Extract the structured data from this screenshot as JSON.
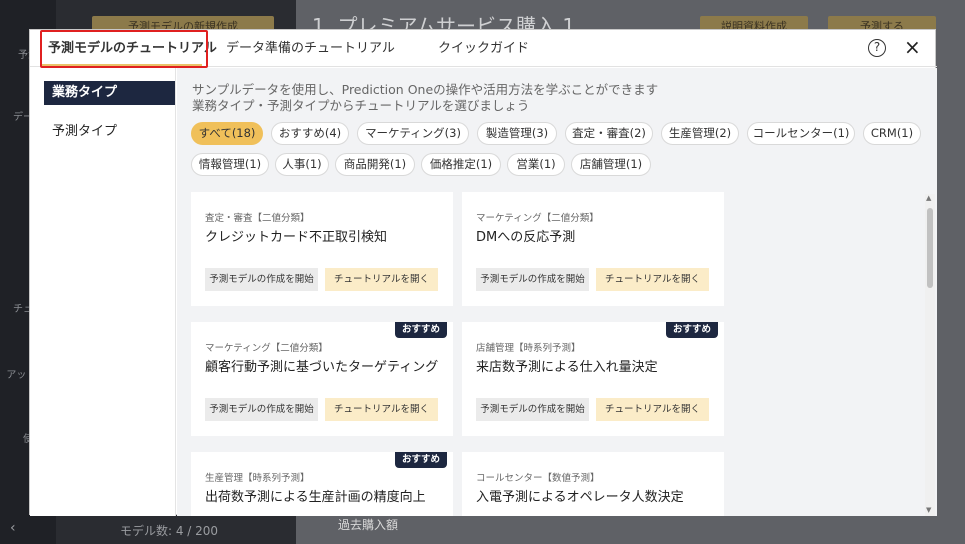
{
  "background": {
    "sidebar_items": [
      "予測",
      "データ",
      "チュー",
      "アッ 済み",
      "使"
    ],
    "panel_button": "予測モデルの新規作成",
    "title": "1. プレミアムサービス購入 1",
    "top_button_1": "説明資料作成",
    "top_button_2": "予測する",
    "footer": "モデル数: 4 / 200",
    "footer_right": "過去購入額"
  },
  "modal": {
    "tabs": [
      {
        "label": "予測モデルのチュートリアル"
      },
      {
        "label": "データ準備のチュートリアル"
      },
      {
        "label": "クイックガイド"
      }
    ],
    "help_icon": "?",
    "close_icon": "×",
    "sidebar": [
      {
        "label": "業務タイプ"
      },
      {
        "label": "予測タイプ"
      }
    ],
    "description_line1": "サンプルデータを使用し、Prediction Oneの操作や活用方法を学ぶことができます",
    "description_line2": "業務タイプ・予測タイプからチュートリアルを選びましょう",
    "filters": [
      {
        "label": "すべて(18)"
      },
      {
        "label": "おすすめ(4)"
      },
      {
        "label": "マーケティング(3)"
      },
      {
        "label": "製造管理(3)"
      },
      {
        "label": "査定・審査(2)"
      },
      {
        "label": "生産管理(2)"
      },
      {
        "label": "コールセンター(1)"
      },
      {
        "label": "CRM(1)"
      },
      {
        "label": "情報管理(1)"
      },
      {
        "label": "人事(1)"
      },
      {
        "label": "商品開発(1)"
      },
      {
        "label": "価格推定(1)"
      },
      {
        "label": "営業(1)"
      },
      {
        "label": "店舗管理(1)"
      }
    ],
    "badge_label": "おすすめ",
    "create_label": "予測モデルの作成を開始",
    "open_label": "チュートリアルを開く",
    "cards": [
      {
        "category": "査定・審査【二値分類】",
        "title": "クレジットカード不正取引検知"
      },
      {
        "category": "マーケティング【二値分類】",
        "title": "DMへの反応予測"
      },
      {
        "category": "マーケティング【二値分類】",
        "title": "顧客行動予測に基づいたターゲティング"
      },
      {
        "category": "店舗管理【時系列予測】",
        "title": "来店数予測による仕入れ量決定"
      },
      {
        "category": "生産管理【時系列予測】",
        "title": "出荷数予測による生産計画の精度向上"
      },
      {
        "category": "コールセンター【数値予測】",
        "title": "入電予測によるオペレータ人数決定"
      }
    ]
  }
}
